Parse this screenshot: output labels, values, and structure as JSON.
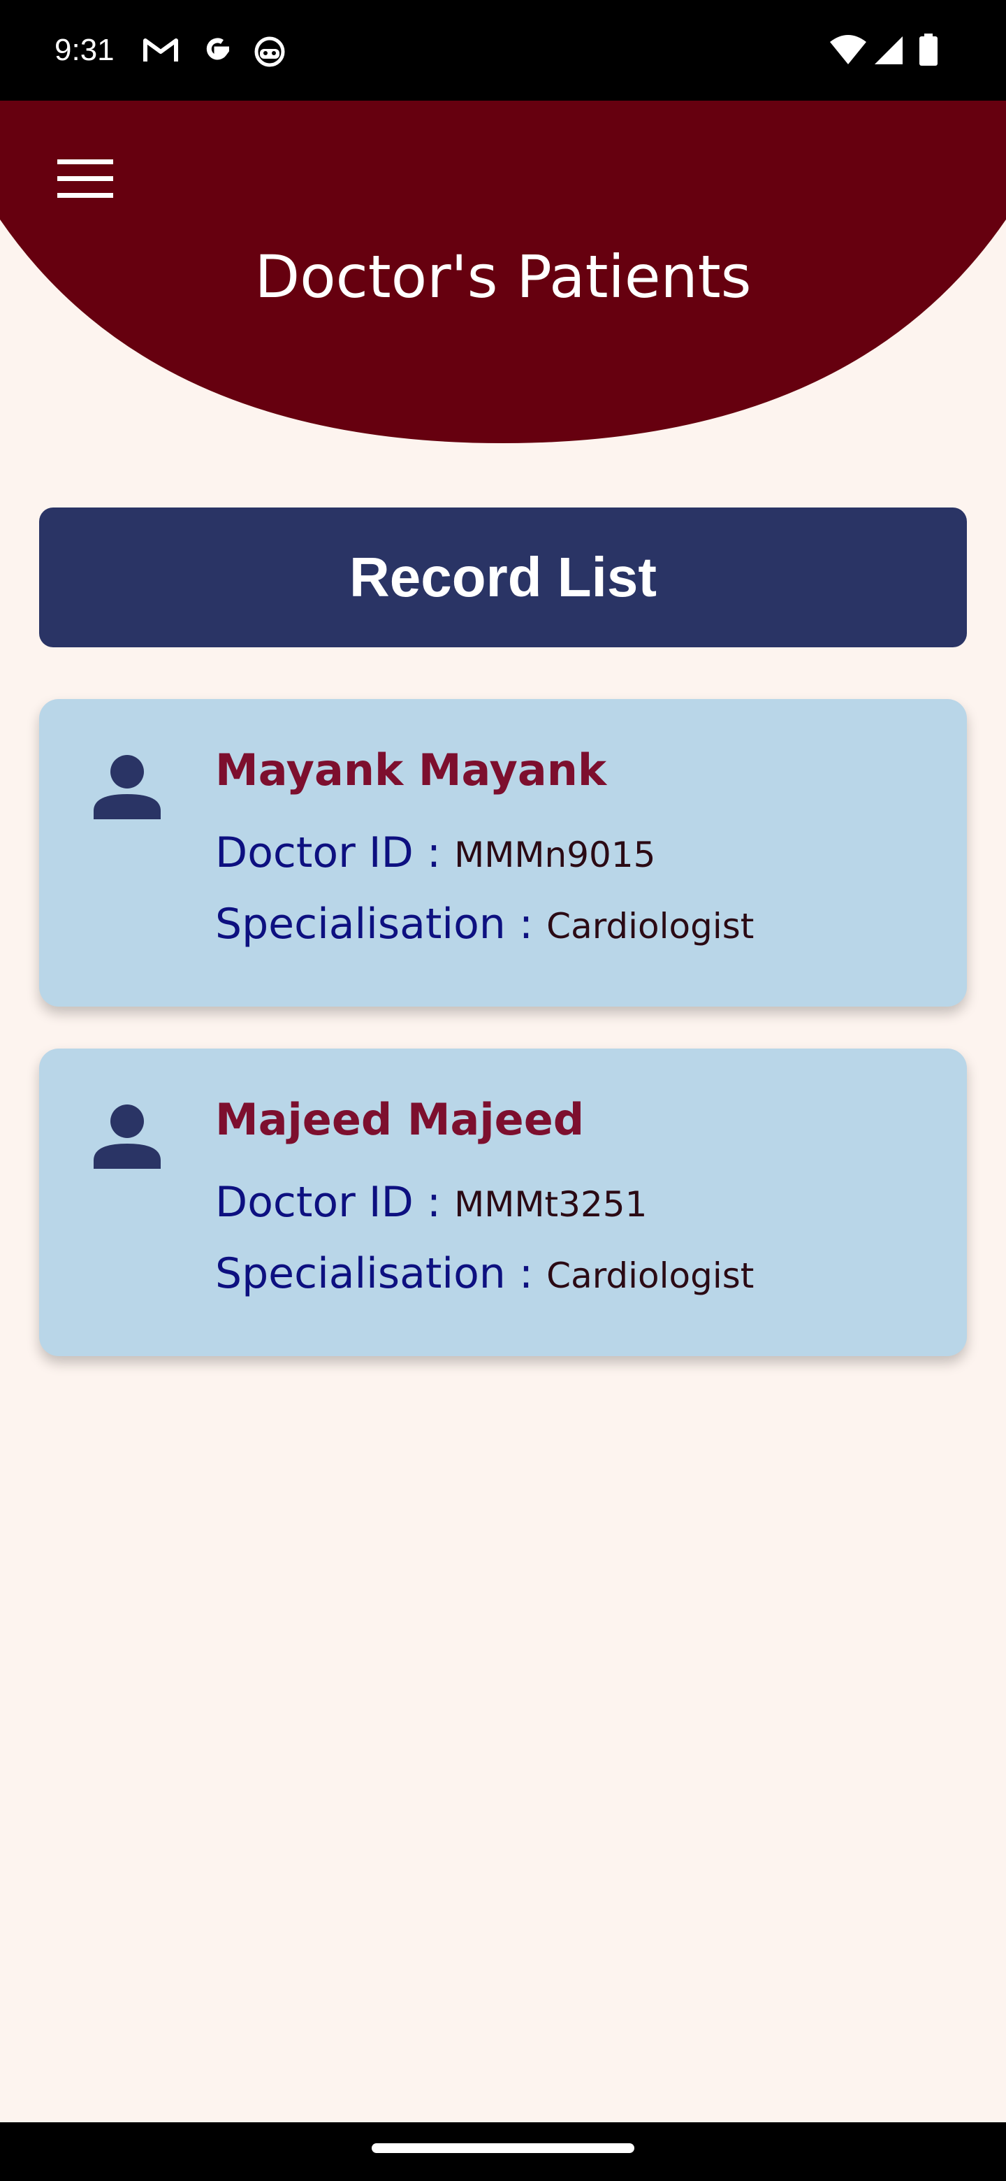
{
  "status_bar": {
    "time": "9:31",
    "left_icons": [
      "gmail-icon",
      "google-icon",
      "android-debug-icon"
    ],
    "right_icons": [
      "wifi-icon",
      "signal-icon",
      "battery-icon"
    ]
  },
  "header": {
    "title": "Doctor's Patients",
    "menu_icon": "hamburger-menu-icon",
    "background_color": "#66000F"
  },
  "record_list": {
    "label": "Record List",
    "color": "#2A3465"
  },
  "labels": {
    "doctor_id": "Doctor ID :",
    "specialisation": "Specialisation :"
  },
  "records": [
    {
      "name": "Mayank Mayank",
      "doctor_id": "MMMn9015",
      "specialisation": "Cardiologist",
      "icon": "person-icon"
    },
    {
      "name": "Majeed Majeed",
      "doctor_id": "MMMt3251",
      "specialisation": "Cardiologist",
      "icon": "person-icon"
    }
  ],
  "colors": {
    "page_background": "#FDF4EF",
    "card_background": "#B9D6E8",
    "name_color": "#7D0F2E",
    "label_color": "#0D1080"
  }
}
